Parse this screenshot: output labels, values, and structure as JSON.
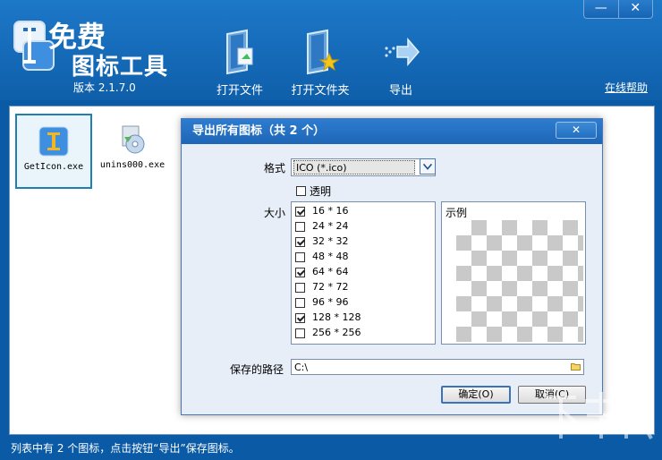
{
  "app": {
    "logo_free": "免费",
    "logo_title": "图标工具",
    "version": "版本 2.1.7.0",
    "help_link": "在线帮助",
    "window_buttons": {
      "minimize": "—",
      "close": "✕"
    }
  },
  "toolbar": {
    "open_file": "打开文件",
    "open_folder": "打开文件夹",
    "export": "导出"
  },
  "files": [
    {
      "name": "GetIcon.exe",
      "selected": true
    },
    {
      "name": "unins000.exe",
      "selected": false
    }
  ],
  "status_text": "列表中有 2 个图标，点击按钮“导出”保存图标。",
  "dialog": {
    "title": "导出所有图标（共 2 个）",
    "close_label": "✕",
    "format_label": "格式",
    "format_value": "ICO (*.ico)",
    "transparent_label": "透明",
    "transparent_checked": false,
    "size_label": "大小",
    "sizes": [
      {
        "label": "16 * 16",
        "checked": true
      },
      {
        "label": "24 * 24",
        "checked": false
      },
      {
        "label": "32 * 32",
        "checked": true
      },
      {
        "label": "48 * 48",
        "checked": false
      },
      {
        "label": "64 * 64",
        "checked": true
      },
      {
        "label": "72 * 72",
        "checked": false
      },
      {
        "label": "96 * 96",
        "checked": false
      },
      {
        "label": "128 * 128",
        "checked": true
      },
      {
        "label": "256 * 256",
        "checked": false
      }
    ],
    "preview_label": "示例",
    "path_label": "保存的路径",
    "path_value": "C:\\",
    "ok_button": "确定(O)",
    "cancel_button": "取消(C)"
  },
  "colors": {
    "accent": "#1665b4",
    "background": "#0a5aa6"
  }
}
